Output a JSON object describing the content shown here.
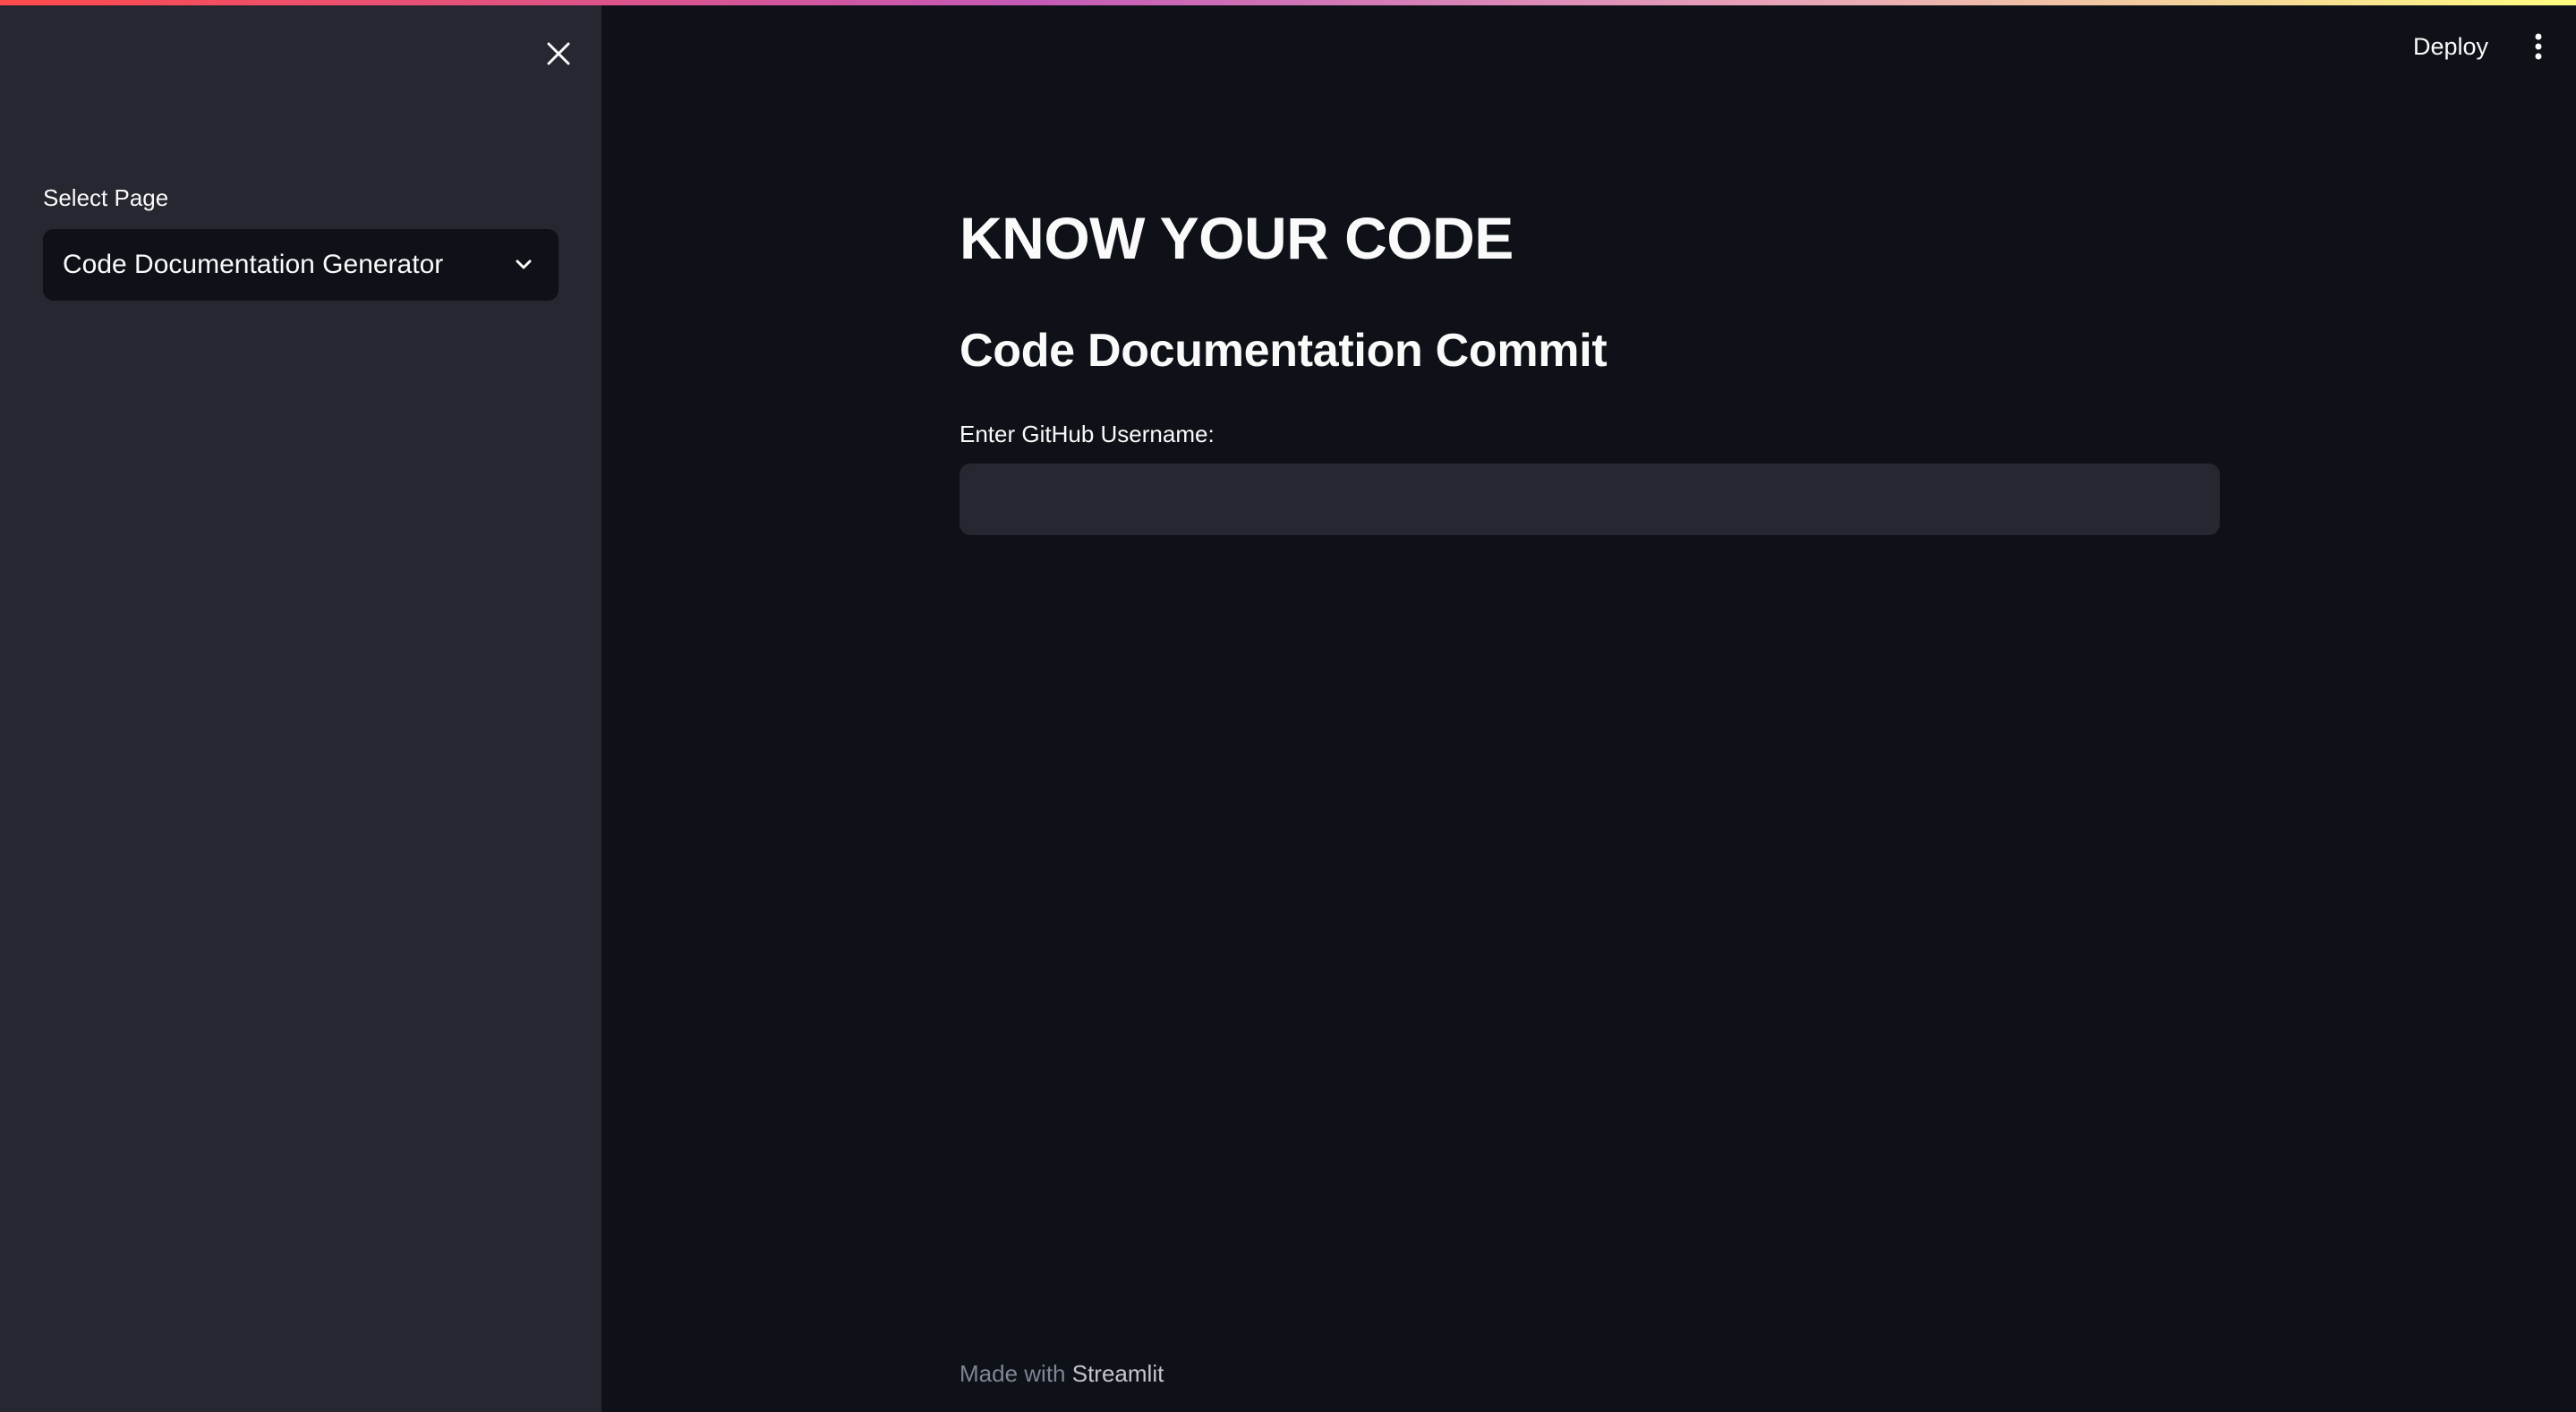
{
  "sidebar": {
    "close_icon": "close-icon",
    "select_label": "Select Page",
    "select_value": "Code Documentation Generator",
    "select_icon": "chevron-down-icon"
  },
  "header": {
    "deploy_label": "Deploy",
    "menu_icon": "more-vertical-icon"
  },
  "main": {
    "title": "KNOW YOUR CODE",
    "subtitle": "Code Documentation Commit",
    "input_label": "Enter GitHub Username:",
    "input_value": ""
  },
  "footer": {
    "prefix": "Made with ",
    "link": "Streamlit"
  },
  "colors": {
    "sidebar_bg": "#262730",
    "main_bg": "#0e1117",
    "text": "#fafafa",
    "muted": "#808495",
    "accent_gradient_start": "#ff4b4b",
    "accent_gradient_end": "#fffd80"
  }
}
